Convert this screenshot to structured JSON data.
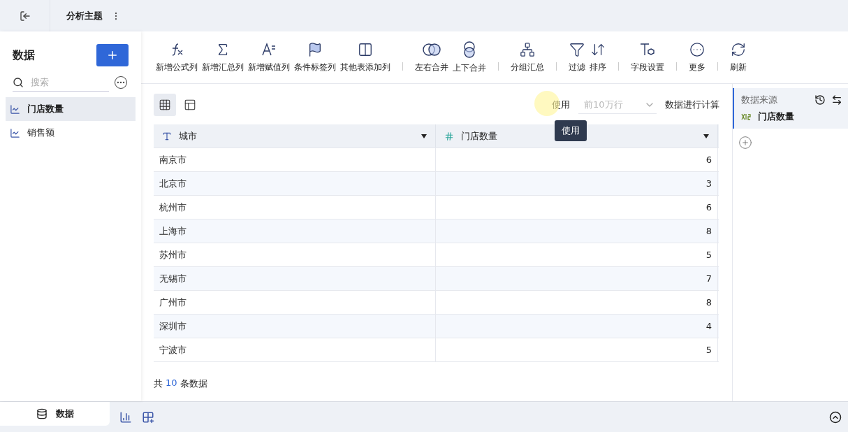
{
  "topbar": {
    "title": "分析主题"
  },
  "sidebar": {
    "title": "数据",
    "search": {
      "placeholder": "搜索"
    },
    "items": [
      {
        "label": "门店数量",
        "selected": true
      },
      {
        "label": "销售额",
        "selected": false
      }
    ]
  },
  "toolbar": {
    "groups": [
      [
        {
          "label": "新增公式列"
        },
        {
          "label": "新增汇总列"
        },
        {
          "label": "新增赋值列"
        },
        {
          "label": "条件标签列"
        },
        {
          "label": "其他表添加列"
        }
      ],
      [
        {
          "label": "左右合并"
        },
        {
          "label": "上下合并"
        }
      ],
      [
        {
          "label": "分组汇总"
        }
      ],
      [
        {
          "label": "过滤"
        },
        {
          "label": "排序"
        }
      ],
      [
        {
          "label": "字段设置"
        }
      ],
      [
        {
          "label": "更多"
        }
      ],
      [
        {
          "label": "刷新"
        }
      ]
    ]
  },
  "view_toggle": [
    {
      "kind": "grid",
      "selected": true
    },
    {
      "kind": "layout",
      "selected": false
    }
  ],
  "calc": {
    "prefix": "使用",
    "select_value": "前10万行",
    "suffix": "数据进行计算",
    "tooltip": "使用"
  },
  "table": {
    "columns": [
      {
        "label": "城市",
        "kind": "text"
      },
      {
        "label": "门店数量",
        "kind": "number"
      }
    ],
    "rows": [
      [
        "南京市",
        "6"
      ],
      [
        "北京市",
        "3"
      ],
      [
        "杭州市",
        "6"
      ],
      [
        "上海市",
        "8"
      ],
      [
        "苏州市",
        "5"
      ],
      [
        "无锡市",
        "7"
      ],
      [
        "广州市",
        "8"
      ],
      [
        "深圳市",
        "4"
      ],
      [
        "宁波市",
        "5"
      ]
    ]
  },
  "footer": {
    "prefix": "共",
    "count": "10",
    "suffix": "条数据"
  },
  "source_panel": {
    "title": "数据来源",
    "file_label": "门店数量"
  },
  "bottom_tab": {
    "label": "数据",
    "selected": true
  }
}
